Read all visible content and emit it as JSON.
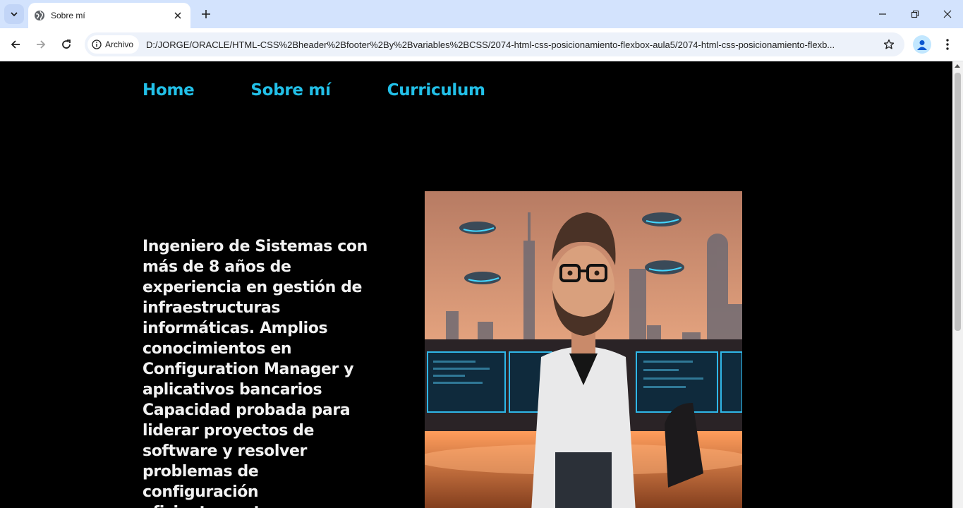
{
  "browser": {
    "tab_title": "Sobre mí",
    "site_chip_label": "Archivo",
    "url": "D:/JORGE/ORACLE/HTML-CSS%2Bheader%2Bfooter%2By%2Bvariables%2BCSS/2074-html-css-posicionamiento-flexbox-aula5/2074-html-css-posicionamiento-flexb..."
  },
  "nav": {
    "items": [
      {
        "label": "Home"
      },
      {
        "label": "Sobre mí"
      },
      {
        "label": "Curriculum"
      }
    ]
  },
  "main": {
    "bio": "Ingeniero de Sistemas con más de 8 años de experiencia en gestión de infraestructuras informáticas. Amplios conocimientos en Configuration Manager y aplicativos bancarios Capacidad probada para liderar proyectos de software y resolver problemas de configuración eficientemente."
  },
  "colors": {
    "nav_link": "#22c0e8",
    "page_background": "#000000",
    "body_text": "#f2f2f2"
  }
}
